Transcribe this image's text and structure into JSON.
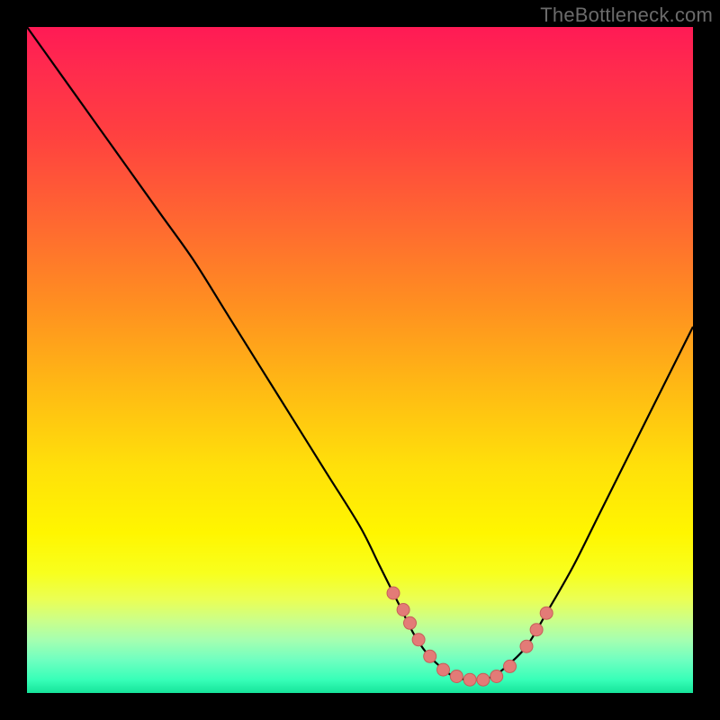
{
  "watermark": "TheBottleneck.com",
  "colors": {
    "background": "#000000",
    "curve": "#000000",
    "dot_fill": "#e37b77",
    "dot_stroke": "#c75d59"
  },
  "chart_data": {
    "type": "line",
    "title": "",
    "xlabel": "",
    "ylabel": "",
    "xlim": [
      0,
      100
    ],
    "ylim": [
      0,
      100
    ],
    "grid": false,
    "legend": false,
    "series": [
      {
        "name": "bottleneck-curve",
        "x": [
          0,
          5,
          10,
          15,
          20,
          25,
          30,
          35,
          40,
          45,
          50,
          53,
          56,
          58,
          60,
          62,
          64,
          66,
          68,
          70,
          72,
          75,
          78,
          82,
          86,
          90,
          94,
          98,
          100
        ],
        "y": [
          100,
          93,
          86,
          79,
          72,
          65,
          57,
          49,
          41,
          33,
          25,
          19,
          13,
          9,
          6,
          4,
          2.5,
          2,
          2,
          2.5,
          4,
          7,
          12,
          19,
          27,
          35,
          43,
          51,
          55
        ]
      }
    ],
    "dots": {
      "name": "highlight-dots",
      "x": [
        55,
        56.5,
        57.5,
        58.8,
        60.5,
        62.5,
        64.5,
        66.5,
        68.5,
        70.5,
        72.5,
        75,
        76.5,
        78
      ],
      "y": [
        15,
        12.5,
        10.5,
        8,
        5.5,
        3.5,
        2.5,
        2,
        2,
        2.5,
        4,
        7,
        9.5,
        12
      ],
      "r": 7
    }
  }
}
